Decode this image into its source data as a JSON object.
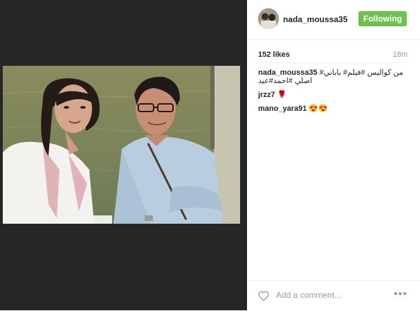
{
  "post": {
    "username": "nada_moussa35",
    "follow_label": "Following",
    "likes": "152 likes",
    "time": "18m"
  },
  "caption": {
    "user": "nada_moussa35",
    "text": "من كواليس #فيلم# باباني# اصلي #احمد#عيد"
  },
  "comments": [
    {
      "user": "jrzz7",
      "text": "🌹"
    },
    {
      "user": "mano_yara91",
      "text": "😍😍"
    }
  ],
  "comment_bar": {
    "placeholder": "Add a comment...",
    "more_label": "•••"
  },
  "colors": {
    "follow_green": "#70c050",
    "hashtag_blue": "#125688",
    "media_background": "#262626"
  },
  "icons": [
    "heart-icon",
    "more-options-icon"
  ]
}
